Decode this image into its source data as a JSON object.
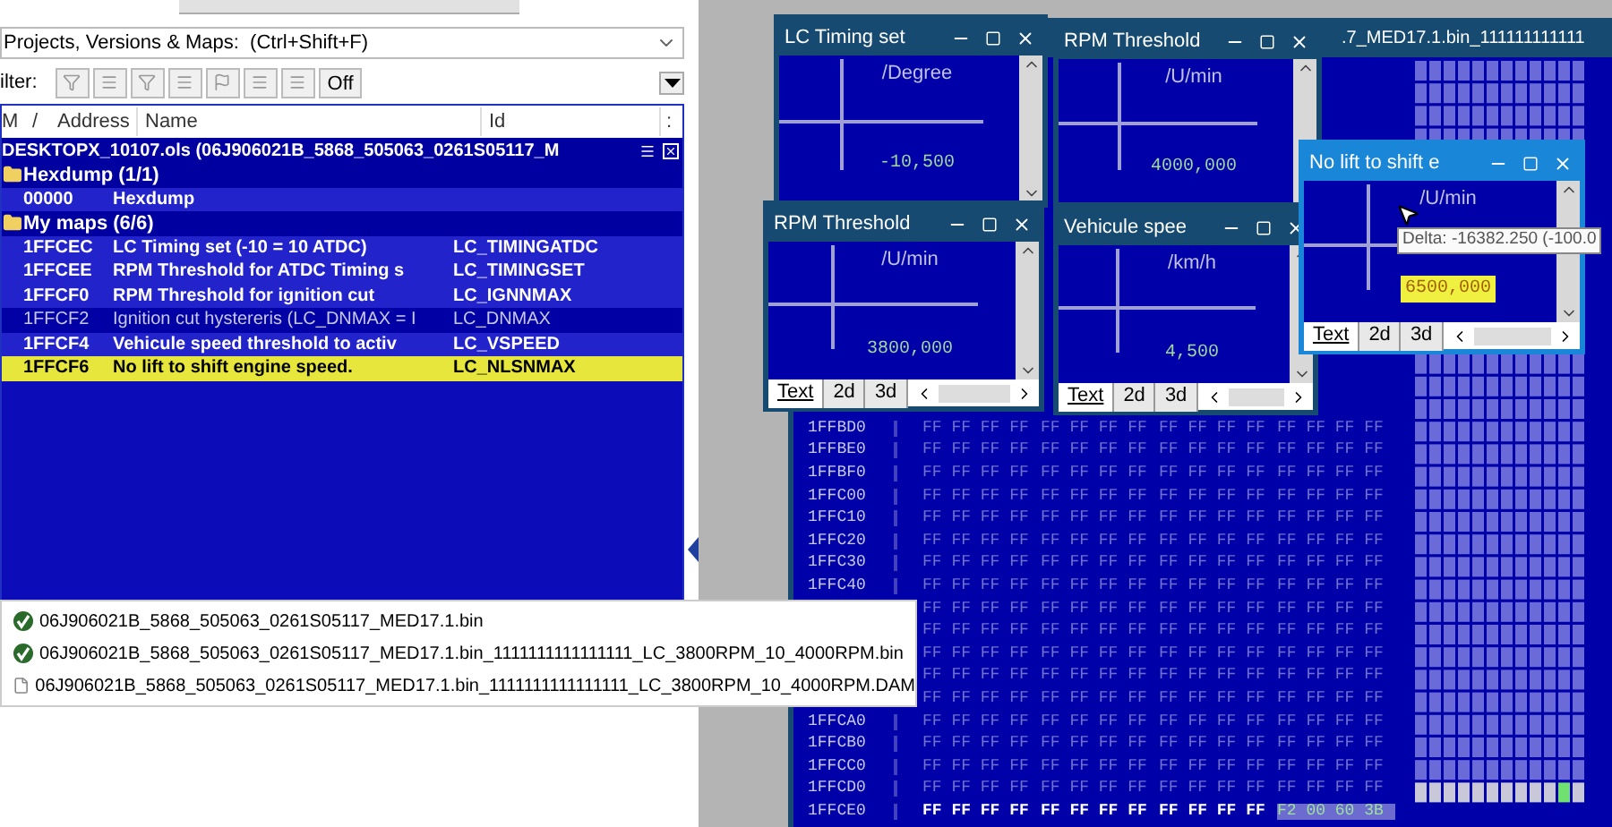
{
  "left_panel": {
    "search_combo": "Projects, Versions & Maps:  (Ctrl+Shift+F)",
    "filter_label": "ilter:",
    "filter_toggle": "Off",
    "columns": [
      "M",
      "/",
      "Address",
      "Name",
      "Id",
      ":"
    ],
    "project": "DESKTOPX_10107.ols (06J906021B_5868_505063_0261S05117_M",
    "groups": [
      {
        "label": "Hexdump (1/1)",
        "rows": [
          {
            "address": "00000",
            "name": "Hexdump",
            "enabled": true,
            "selected": false
          }
        ]
      },
      {
        "label": "My maps (6/6)",
        "rows": [
          {
            "address": "1FFCEC",
            "name": "LC Timing set (-10 = 10 ATDC)",
            "id": "LC_TIMINGATDC",
            "enabled": true,
            "selected": false
          },
          {
            "address": "1FFCEE",
            "name": "RPM Threshold for ATDC Timing s",
            "id": "LC_TIMINGSET",
            "enabled": true,
            "selected": false
          },
          {
            "address": "1FFCF0",
            "name": "RPM Threshold for ignition cut",
            "id": "LC_IGNNMAX",
            "enabled": true,
            "selected": false
          },
          {
            "address": "1FFCF2",
            "name": "Ignition cut hystereris (LC_DNMAX = I",
            "id": "LC_DNMAX",
            "enabled": false,
            "selected": false
          },
          {
            "address": "1FFCF4",
            "name": "Vehicule speed threshold to activ",
            "id": "LC_VSPEED",
            "enabled": true,
            "selected": false
          },
          {
            "address": "1FFCF6",
            "name": "No lift to shift engine speed.",
            "id": "LC_NLSNMAX",
            "enabled": true,
            "selected": true
          }
        ]
      }
    ]
  },
  "hex_window": {
    "title": ".7_MED17.1.bin_111111111111",
    "rows": [
      {
        "address": "1FFBD0",
        "groups": [
          "FF FF FF FF",
          "FF FF FF FF",
          "FF FF FF FF",
          "FF FF FF FF"
        ],
        "modified": false
      },
      {
        "address": "1FFBE0",
        "groups": [
          "FF FF FF FF",
          "FF FF FF FF",
          "FF FF FF FF",
          "FF FF FF FF"
        ],
        "modified": false
      },
      {
        "address": "1FFBF0",
        "groups": [
          "FF FF FF FF",
          "FF FF FF FF",
          "FF FF FF FF",
          "FF FF FF FF"
        ],
        "modified": false
      },
      {
        "address": "1FFC00",
        "groups": [
          "FF FF FF FF",
          "FF FF FF FF",
          "FF FF FF FF",
          "FF FF FF FF"
        ],
        "modified": false
      },
      {
        "address": "1FFC10",
        "groups": [
          "FF FF FF FF",
          "FF FF FF FF",
          "FF FF FF FF",
          "FF FF FF FF"
        ],
        "modified": false
      },
      {
        "address": "1FFC20",
        "groups": [
          "FF FF FF FF",
          "FF FF FF FF",
          "FF FF FF FF",
          "FF FF FF FF"
        ],
        "modified": false
      },
      {
        "address": "1FFC30",
        "groups": [
          "FF FF FF FF",
          "FF FF FF FF",
          "FF FF FF FF",
          "FF FF FF FF"
        ],
        "modified": false
      },
      {
        "address": "1FFC40",
        "groups": [
          "FF FF FF FF",
          "FF FF FF FF",
          "FF FF FF FF",
          "FF FF FF FF"
        ],
        "modified": false
      },
      {
        "groups": [
          "FF FF FF FF",
          "FF FF FF FF",
          "FF FF FF FF",
          "FF FF FF FF"
        ],
        "modified": false
      },
      {
        "groups": [
          "FF FF FF FF",
          "FF FF FF FF",
          "FF FF FF FF",
          "FF FF FF FF"
        ],
        "modified": false
      },
      {
        "groups": [
          "FF FF FF FF",
          "FF FF FF FF",
          "FF FF FF FF",
          "FF FF FF FF"
        ],
        "modified": false
      },
      {
        "groups": [
          "FF FF FF FF",
          "FF FF FF FF",
          "FF FF FF FF",
          "FF FF FF FF"
        ],
        "modified": false
      },
      {
        "groups": [
          "FF FF FF FF",
          "FF FF FF FF",
          "FF FF FF FF",
          "FF FF FF FF"
        ],
        "modified": false
      },
      {
        "address": "1FFCA0",
        "groups": [
          "FF FF FF FF",
          "FF FF FF FF",
          "FF FF FF FF",
          "FF FF FF FF"
        ],
        "modified": false
      },
      {
        "address": "1FFCB0",
        "groups": [
          "FF FF FF FF",
          "FF FF FF FF",
          "FF FF FF FF",
          "FF FF FF FF"
        ],
        "modified": false
      },
      {
        "address": "1FFCC0",
        "groups": [
          "FF FF FF FF",
          "FF FF FF FF",
          "FF FF FF FF",
          "FF FF FF FF"
        ],
        "modified": false
      },
      {
        "address": "1FFCD0",
        "groups": [
          "FF FF FF FF",
          "FF FF FF FF",
          "FF FF FF FF",
          "FF FF FF FF"
        ],
        "modified": false
      },
      {
        "address": "1FFCE0",
        "groups": [
          "FF FF FF FF",
          "FF FF FF FF",
          "FF FF FF FF"
        ],
        "changed_group": "F2 00 60 3B",
        "modified": true
      }
    ]
  },
  "map_windows": [
    {
      "title": "LC Timing set",
      "unit": "/Degree",
      "value": "-10,500",
      "active": false,
      "value_highlighted": false
    },
    {
      "title": "RPM Threshold",
      "unit": "/U/min",
      "value": "4000,000",
      "active": false,
      "value_highlighted": false
    },
    {
      "title": "RPM Threshold",
      "unit": "/U/min",
      "value": "3800,000",
      "active": false,
      "value_highlighted": false,
      "tabs": [
        {
          "label": "Text",
          "selected": true
        },
        {
          "label": "2d",
          "selected": false
        },
        {
          "label": "3d",
          "selected": false
        }
      ]
    },
    {
      "title": "Vehicule spee",
      "unit": "/km/h",
      "value": "4,500",
      "active": false,
      "value_highlighted": false,
      "tabs": [
        {
          "label": "Text",
          "selected": true
        },
        {
          "label": "2d",
          "selected": false
        },
        {
          "label": "3d",
          "selected": false
        }
      ]
    },
    {
      "title": "No lift to shift e",
      "unit": "/U/min",
      "value": "6500,000",
      "active": true,
      "value_highlighted": true,
      "tabs": [
        {
          "label": "Text",
          "selected": true
        },
        {
          "label": "2d",
          "selected": false
        },
        {
          "label": "3d",
          "selected": false
        }
      ]
    }
  ],
  "tooltip": "Delta: -16382.250 (-100.0",
  "file_popup": {
    "items": [
      {
        "kind": "binary",
        "name": "06J906021B_5868_505063_0261S05117_MED17.1.bin"
      },
      {
        "kind": "binary",
        "name": "06J906021B_5868_505063_0261S05117_MED17.1.bin_1111111111111111_LC_3800RPM_10_4000RPM.bin"
      },
      {
        "kind": "document",
        "name": "06J906021B_5868_505063_0261S05117_MED17.1.bin_1111111111111111_LC_3800RPM_10_4000RPM.DAM"
      }
    ]
  }
}
